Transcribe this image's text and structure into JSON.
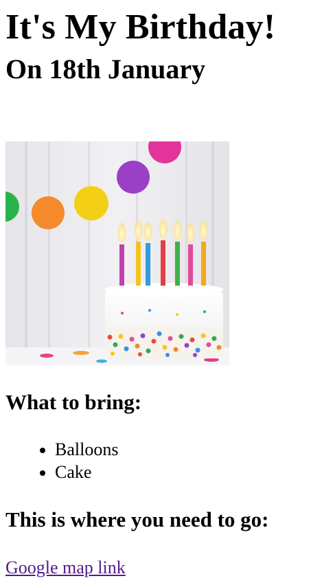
{
  "page": {
    "title": "It's My Birthday!",
    "subtitle": "On 18th January"
  },
  "image": {
    "alt": "Birthday cake with candles and balloons"
  },
  "bring": {
    "heading": "What to bring:",
    "items": [
      "Balloons",
      "Cake"
    ]
  },
  "location": {
    "heading": "This is where you need to go:",
    "link_text": "Google map link"
  },
  "colors": {
    "link_visited": "#551a8b",
    "text": "#000000",
    "background": "#ffffff"
  }
}
